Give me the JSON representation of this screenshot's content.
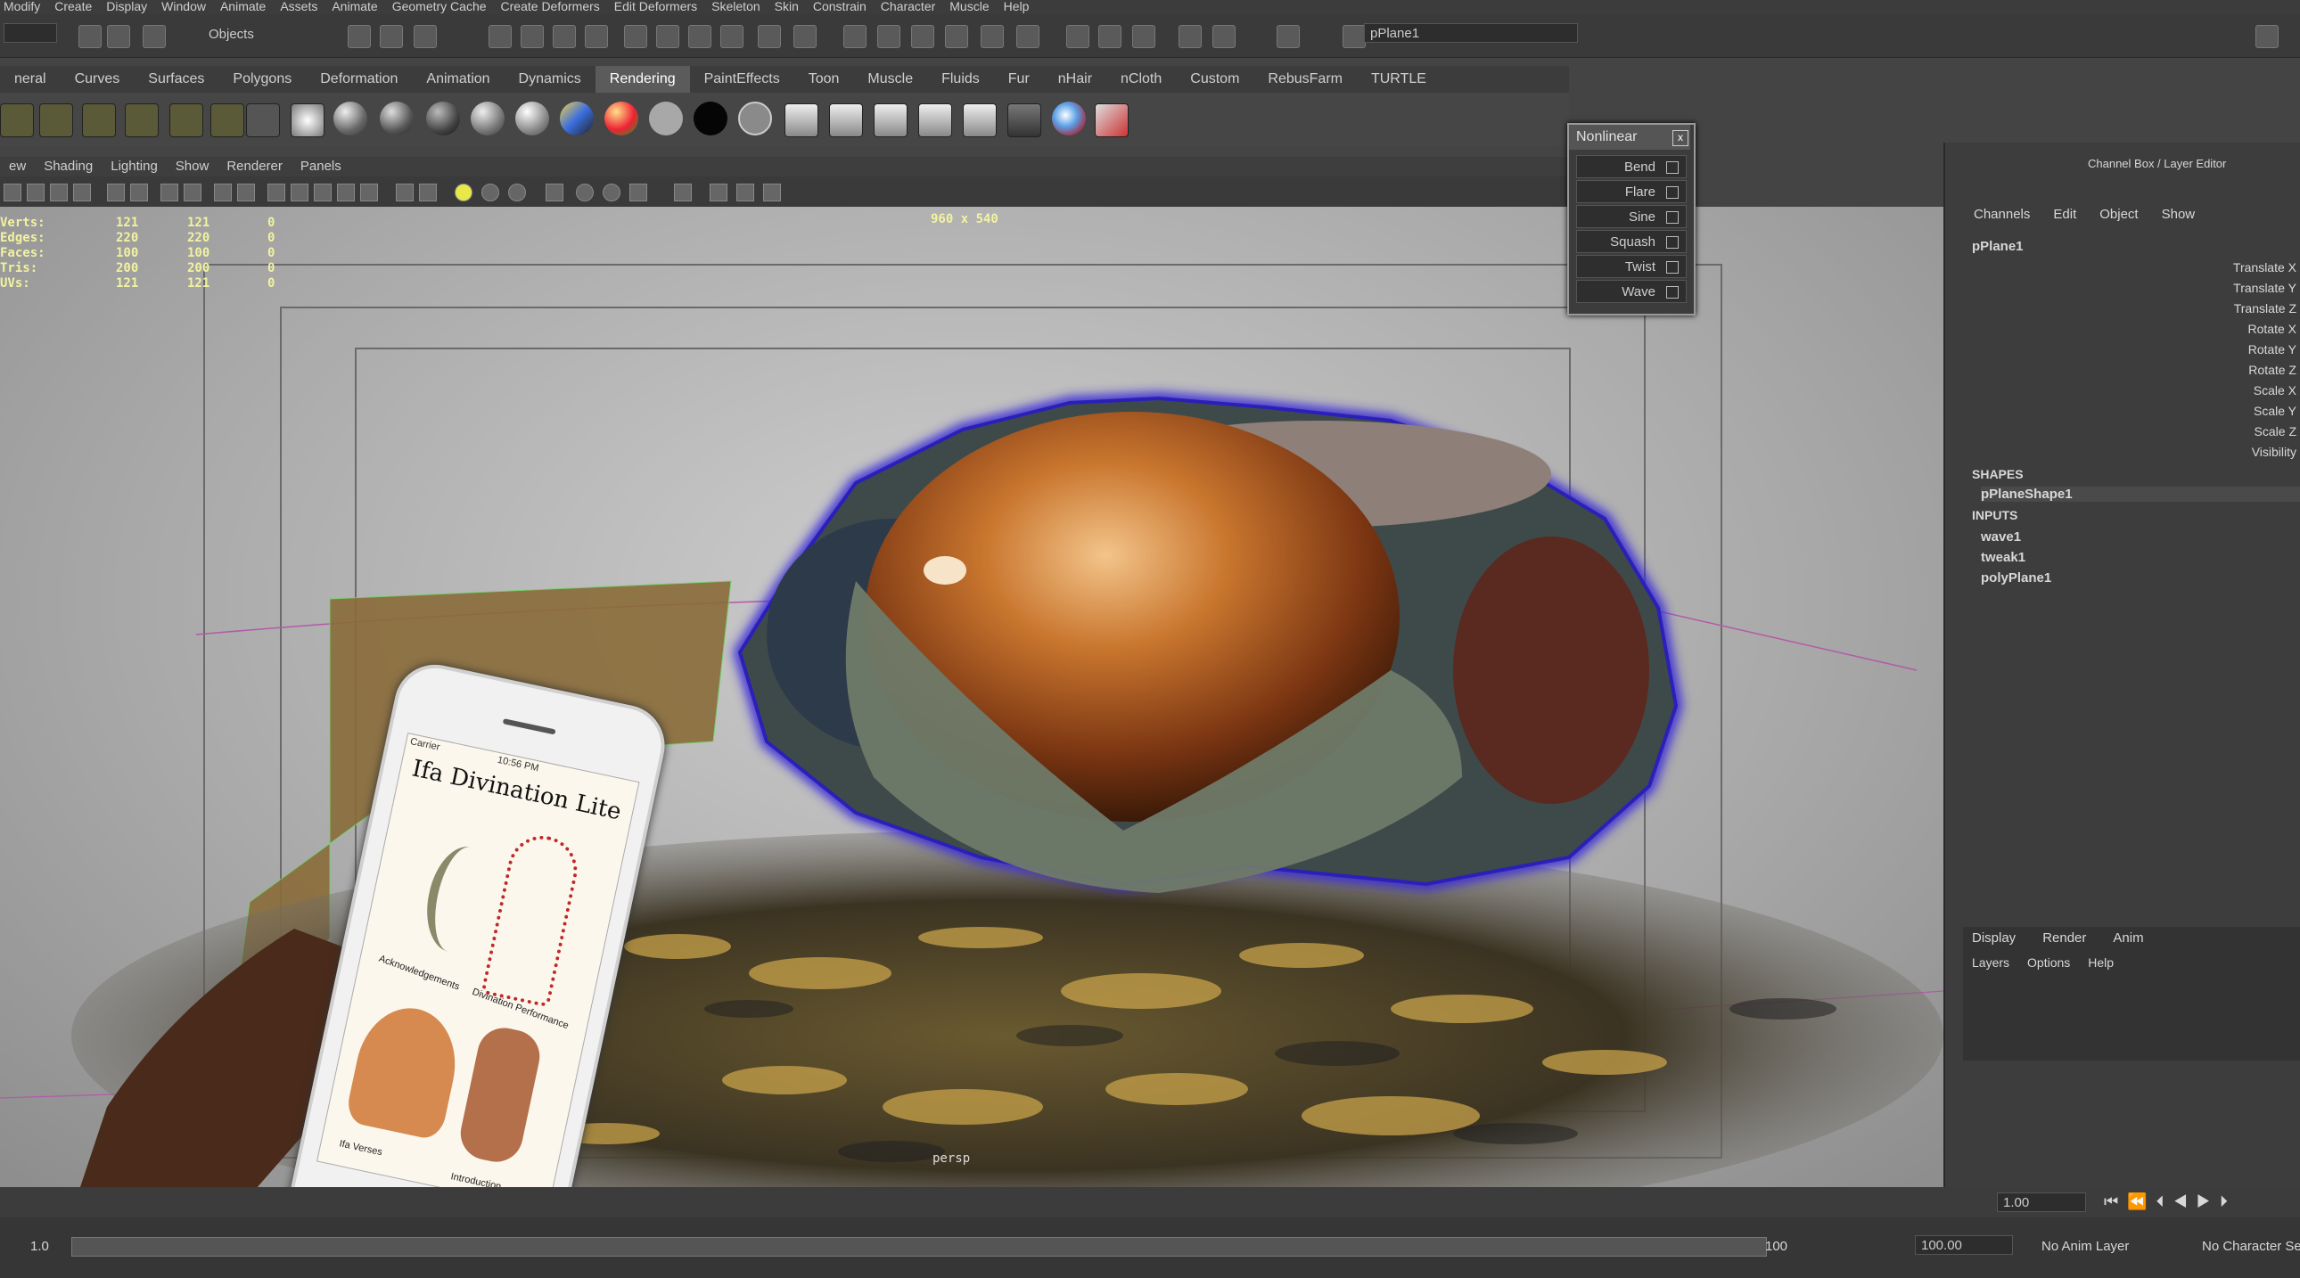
{
  "menubar": {
    "items": [
      "Modify",
      "Create",
      "Display",
      "Window",
      "Animate",
      "Assets",
      "Animate",
      "Geometry Cache",
      "Create Deformers",
      "Edit Deformers",
      "Skeleton",
      "Skin",
      "Constrain",
      "Character",
      "Muscle",
      "Help"
    ]
  },
  "statusline": {
    "selection_mode": "Objects",
    "object_field": "pPlane1"
  },
  "shelf": {
    "tabs": [
      "neral",
      "Curves",
      "Surfaces",
      "Polygons",
      "Deformation",
      "Animation",
      "Dynamics",
      "Rendering",
      "PaintEffects",
      "Toon",
      "Muscle",
      "Fluids",
      "Fur",
      "nHair",
      "nCloth",
      "Custom",
      "RebusFarm",
      "TURTLE"
    ],
    "active_tab": "Rendering"
  },
  "panel": {
    "menu": [
      "ew",
      "Shading",
      "Lighting",
      "Show",
      "Renderer",
      "Panels"
    ]
  },
  "viewport": {
    "resolution": "960 x 540",
    "hud": [
      {
        "label": "Verts:",
        "a": "121",
        "b": "121",
        "c": "0"
      },
      {
        "label": "Edges:",
        "a": "220",
        "b": "220",
        "c": "0"
      },
      {
        "label": "Faces:",
        "a": "100",
        "b": "100",
        "c": "0"
      },
      {
        "label": "Tris:",
        "a": "200",
        "b": "200",
        "c": "0"
      },
      {
        "label": "UVs:",
        "a": "121",
        "b": "121",
        "c": "0"
      }
    ],
    "camera_label": "persp"
  },
  "nonlinear": {
    "title": "Nonlinear",
    "close": "x",
    "items": [
      "Bend",
      "Flare",
      "Sine",
      "Squash",
      "Twist",
      "Wave"
    ]
  },
  "phone": {
    "carrier": "Carrier",
    "time": "10:56 PM",
    "app_title": "Ifa Divination Lite",
    "labels": [
      "Acknowledgements",
      "Divination Performance",
      "Ifa Verses",
      "Introduction"
    ]
  },
  "channelbox": {
    "header": "Channel Box / Layer Editor",
    "menu": [
      "Channels",
      "Edit",
      "Object",
      "Show"
    ],
    "object": "pPlane1",
    "attributes": [
      "Translate X",
      "Translate Y",
      "Translate Z",
      "Rotate X",
      "Rotate Y",
      "Rotate Z",
      "Scale X",
      "Scale Y",
      "Scale Z",
      "Visibility"
    ],
    "shapes_header": "SHAPES",
    "shape": "pPlaneShape1",
    "inputs_header": "INPUTS",
    "inputs": [
      "wave1",
      "tweak1",
      "polyPlane1"
    ],
    "layer_tabs": [
      "Display",
      "Render",
      "Anim"
    ],
    "layer_menu": [
      "Layers",
      "Options",
      "Help"
    ]
  },
  "timeline": {
    "current_frame": "1.00",
    "range_start": "1.0",
    "range_end": "100",
    "anim_end": "100.00",
    "anim_layer": "No Anim Layer",
    "character": "No Character Set"
  },
  "colors": {
    "accent_tab": "#5b5b5b",
    "hud_text": "#f2f2a0",
    "cowrie_glow": "#3a2bd8"
  }
}
